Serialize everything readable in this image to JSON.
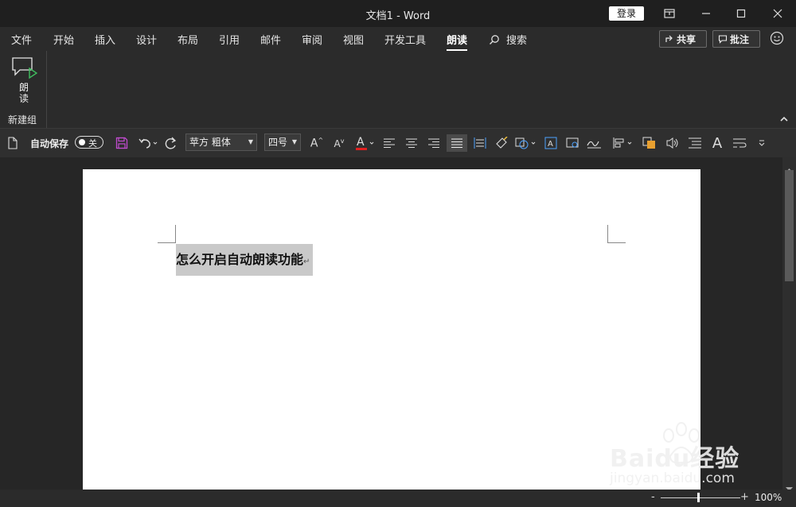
{
  "window": {
    "title": "文档1  -  Word",
    "login_label": "登录"
  },
  "tabs": [
    {
      "label": "文件"
    },
    {
      "label": "开始"
    },
    {
      "label": "插入"
    },
    {
      "label": "设计"
    },
    {
      "label": "布局"
    },
    {
      "label": "引用"
    },
    {
      "label": "邮件"
    },
    {
      "label": "审阅"
    },
    {
      "label": "视图"
    },
    {
      "label": "开发工具"
    },
    {
      "label": "朗读"
    }
  ],
  "search_label": "搜索",
  "share_label": "共享",
  "comment_label": "批注",
  "ribbon": {
    "read_label_1": "朗",
    "read_label_2": "读",
    "group_label": "新建组"
  },
  "qat": {
    "autosave_label": "自动保存",
    "autosave_state": "关",
    "font_name": "苹方 粗体",
    "font_size": "四号"
  },
  "document": {
    "heading": "怎么开启自动朗读功能"
  },
  "status": {
    "zoom_minus": "-",
    "zoom_plus": "+",
    "zoom": "100%"
  },
  "watermark": {
    "brand": "Baidu经验",
    "url": "jingyan.baidu.com"
  },
  "colors": {
    "font_color_bar": "#e02020",
    "save_icon": "#c24bd0",
    "read_icon_accent": "#3fbf5f"
  }
}
